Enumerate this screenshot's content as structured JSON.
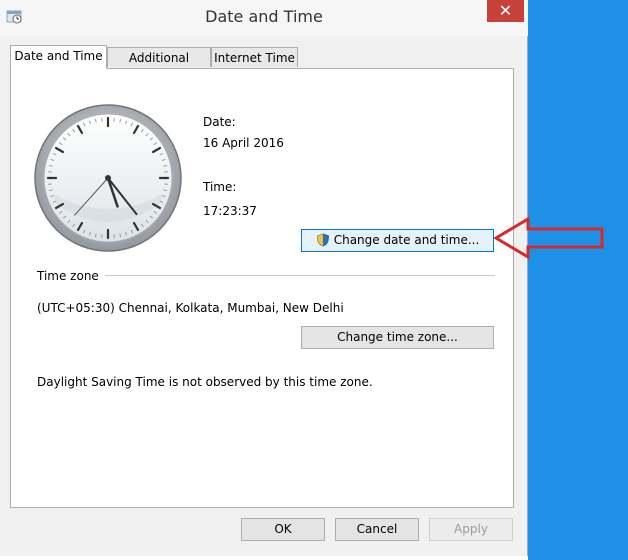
{
  "window": {
    "title": "Date and Time",
    "close_label": "✕"
  },
  "tabs": [
    {
      "label": "Date and Time"
    },
    {
      "label": "Additional Clocks"
    },
    {
      "label": "Internet Time"
    }
  ],
  "datetime": {
    "date_label": "Date:",
    "date_value": "16 April 2016",
    "time_label": "Time:",
    "time_value": "17:23:37",
    "change_button": "Change date and time..."
  },
  "timezone": {
    "section_label": "Time zone",
    "value": "(UTC+05:30) Chennai, Kolkata, Mumbai, New Delhi",
    "change_button": "Change time zone...",
    "dst_note": "Daylight Saving Time is not observed by this time zone."
  },
  "footer": {
    "ok": "OK",
    "cancel": "Cancel",
    "apply": "Apply"
  },
  "colors": {
    "accent_blue": "#1e90e8",
    "close_red": "#c7413b",
    "annotation_red": "#d62a2a"
  },
  "icons": [
    "datetime-app-icon",
    "close-icon",
    "clock-face",
    "uac-shield-icon",
    "annotation-arrow"
  ]
}
